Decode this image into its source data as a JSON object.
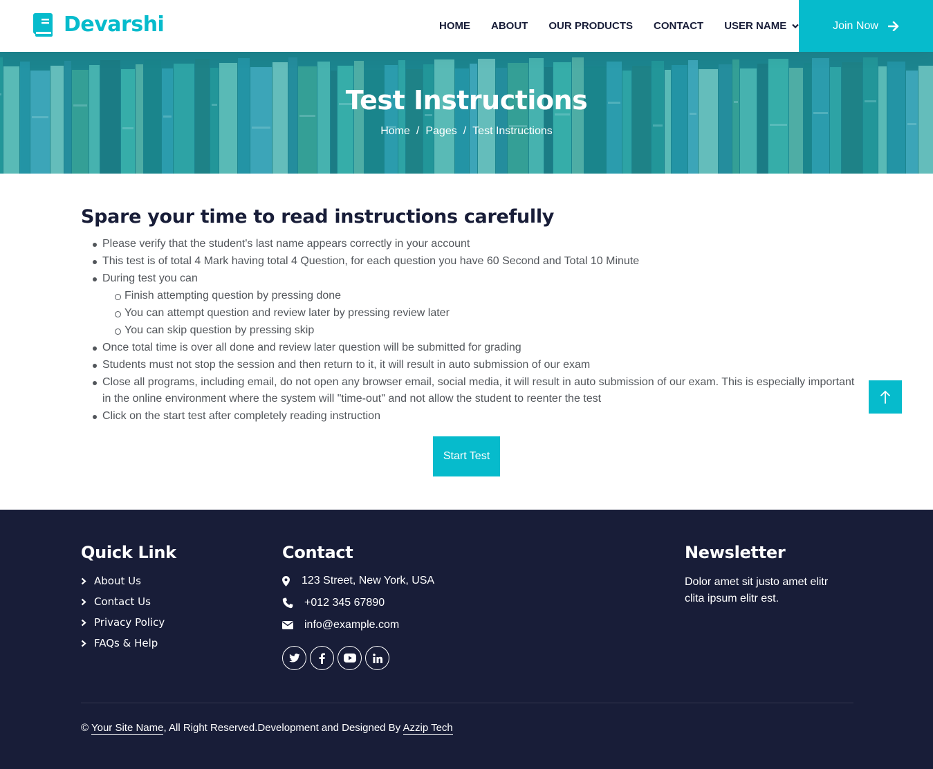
{
  "brand": {
    "name": "Devarshi",
    "icon": "book-icon"
  },
  "nav": {
    "items": [
      "HOME",
      "ABOUT",
      "OUR PRODUCTS",
      "CONTACT",
      "USER NAME"
    ],
    "join_label": "Join Now"
  },
  "hero": {
    "title": "Test Instructions",
    "breadcrumb": [
      "Home",
      "Pages",
      "Test Instructions"
    ],
    "separator": "/"
  },
  "instructions": {
    "heading": "Spare your time to read instructions carefully",
    "items": [
      "Please verify that the student's last name appears correctly in your account",
      "This test is of total 4 Mark having total 4 Question, for each question you have 60 Second and Total 10 Minute",
      "During test you can",
      "Once total time is over all done and review later question will be submitted for grading",
      "Students must not stop the session and then return to it, it will result in auto submission of our exam",
      "Close all programs, including email, do not open any browser email, social media, it will result in auto submission of our exam. This is especially important in the online environment where the system will \"time-out\" and not allow the student to reenter the test",
      "Click on the start test after completely reading instruction"
    ],
    "subitems": [
      "Finish attempting question by pressing done",
      "You can attempt question and review later by pressing review later",
      "You can skip question by pressing skip"
    ],
    "start_label": "Start Test"
  },
  "footer": {
    "quick_title": "Quick Link",
    "quick_links": [
      "About Us",
      "Contact Us",
      "Privacy Policy",
      "FAQs & Help"
    ],
    "contact_title": "Contact",
    "address": "123 Street, New York, USA",
    "phone": "+012 345 67890",
    "email": "info@example.com",
    "socials": [
      "twitter-icon",
      "facebook-icon",
      "youtube-icon",
      "linkedin-icon"
    ],
    "newsletter_title": "Newsletter",
    "newsletter_text": "Dolor amet sit justo amet elitr clita ipsum elitr est.",
    "copyright_prefix": "©",
    "site_name": "Your Site Name",
    "copyright_mid": ", All Right Reserved.Development and Designed By",
    "designer": "Azzip Tech"
  },
  "colors": {
    "primary": "#06bbcc",
    "dark": "#181d38",
    "text": "#52565b"
  }
}
